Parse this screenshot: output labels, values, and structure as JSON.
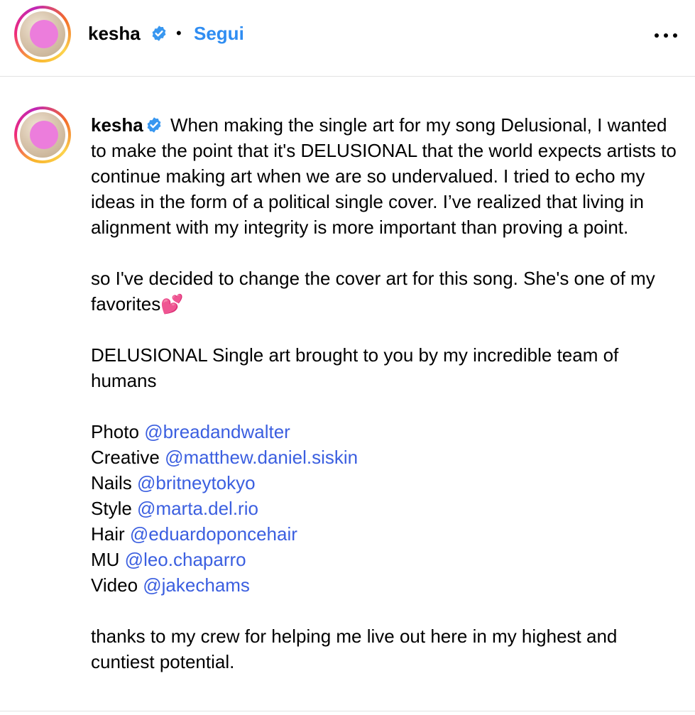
{
  "header": {
    "username": "kesha",
    "separator": "•",
    "follow_label": "Segui",
    "avatar_icon": "profile-photo",
    "verified_icon": "verified-badge-icon",
    "more_icon": "more-options-icon"
  },
  "caption": {
    "username": "kesha",
    "intro_text": " When making the single art for my song Delusional, I wanted to make the point that it's DELUSIONAL that the world expects artists to continue making art when we are so undervalued. I tried to echo my ideas in the form of a political single cover.  I’ve realized that living in alignment with my integrity is more important than proving a point.",
    "change_text": "so I've decided to change the cover art for this song. She's one of my favorites💕",
    "team_text": "DELUSIONAL Single art brought to you by my incredible team of humans",
    "credits": [
      {
        "role": "Photo",
        "handle": "@breadandwalter"
      },
      {
        "role": "Creative",
        "handle": "@matthew.daniel.siskin"
      },
      {
        "role": "Nails",
        "handle": "@britneytokyo"
      },
      {
        "role": "Style",
        "handle": "@marta.del.rio"
      },
      {
        "role": "Hair",
        "handle": "@eduardoponcehair"
      },
      {
        "role": "MU",
        "handle": "@leo.chaparro"
      },
      {
        "role": "Video",
        "handle": "@jakechams"
      }
    ],
    "closing_text": "thanks to my crew for helping me live out here in my highest and cuntiest potential."
  },
  "colors": {
    "follow_blue": "#2f8df2",
    "mention_blue": "#3b5fe0",
    "verified_blue": "#3897f0",
    "divider": "#e2e2e2"
  }
}
